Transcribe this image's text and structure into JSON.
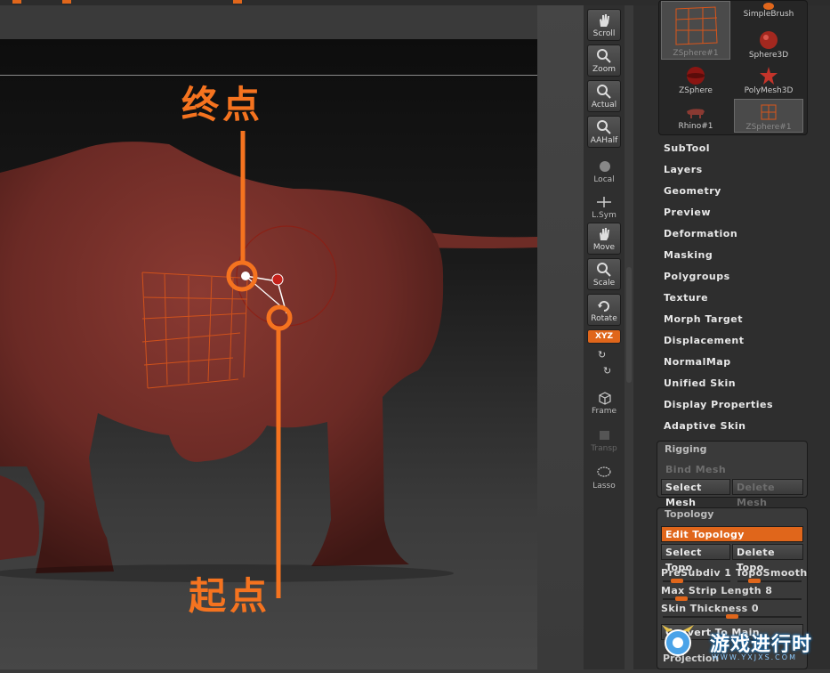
{
  "viewport": {
    "annotations": {
      "end_point": "终点",
      "start_point": "起点"
    }
  },
  "toolbar": {
    "buttons": [
      {
        "label": "Scroll",
        "icon": "scroll-hand-icon"
      },
      {
        "label": "Zoom",
        "icon": "zoom-magnifier-icon"
      },
      {
        "label": "Actual",
        "icon": "actual-size-icon"
      },
      {
        "label": "AAHalf",
        "icon": "aahalf-icon"
      },
      {
        "label": "Local",
        "icon": "local-sphere-icon"
      },
      {
        "label": "L.Sym",
        "icon": "local-symmetry-icon"
      },
      {
        "label": "Move",
        "icon": "move-hand-icon"
      },
      {
        "label": "Scale",
        "icon": "scale-icon"
      },
      {
        "label": "Rotate",
        "icon": "rotate-icon"
      },
      {
        "label": "XYZ",
        "icon": "xyz-rotate-icon"
      },
      {
        "label": "Frame",
        "icon": "frame-cube-icon"
      },
      {
        "label": "Transp",
        "icon": "transparency-icon"
      },
      {
        "label": "Lasso",
        "icon": "lasso-icon"
      }
    ]
  },
  "tool_palette": {
    "items": [
      {
        "label": "ZSphere#1"
      },
      {
        "label": "SimpleBrush"
      },
      {
        "label": "Sphere3D"
      },
      {
        "label": "ZSphere"
      },
      {
        "label": "PolyMesh3D"
      },
      {
        "label": "Rhino#1"
      },
      {
        "label": "ZSphere#1"
      }
    ]
  },
  "menu": [
    "SubTool",
    "Layers",
    "Geometry",
    "Preview",
    "Deformation",
    "Masking",
    "Polygroups",
    "Texture",
    "Morph Target",
    "Displacement",
    "NormalMap",
    "Unified Skin",
    "Display Properties",
    "Adaptive Skin"
  ],
  "rigging": {
    "title": "Rigging",
    "bind_mesh": "Bind Mesh",
    "select_mesh": "Select Mesh",
    "delete_mesh": "Delete Mesh"
  },
  "topology": {
    "title": "Topology",
    "edit_topology": "Edit Topology",
    "select_topo": "Select Topo",
    "delete_topo": "Delete Topo",
    "presubdiv": "PreSubdiv 1",
    "presubdiv_level": 0.15,
    "toposmooth": "TopoSmooth",
    "toposmooth_level": 0.2,
    "max_strip_length": "Max Strip Length 8",
    "max_strip_length_level": 0.1,
    "skin_thickness": "Skin Thickness 0",
    "skin_thickness_level": 0.5,
    "convert_to_main": "Convert To Main"
  },
  "projection_label": "Projection",
  "watermark": {
    "text": "游戏进行时",
    "url_text": "WWW.YXJXS.COM"
  },
  "colors": {
    "accent": "#e0661b",
    "annotation": "#f5731f",
    "model": "#6b2a25"
  }
}
